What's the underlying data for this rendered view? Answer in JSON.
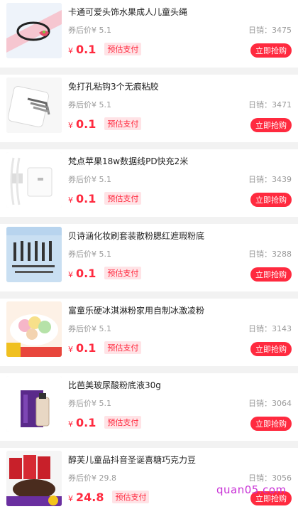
{
  "products": [
    {
      "title": "卡通可爱头饰水果成人儿童头绳",
      "coupon_label": "券后价",
      "coupon_price": "¥ 5.1",
      "sales_label": "日销：",
      "sales": "3475",
      "currency": "¥",
      "price": "0.1",
      "tag": "预估支付",
      "button": "立即抢购",
      "icon": "hair-tie-image"
    },
    {
      "title": "免打孔粘钩3个无痕粘胶",
      "coupon_label": "券后价",
      "coupon_price": "¥ 5.1",
      "sales_label": "日销：",
      "sales": "3471",
      "currency": "¥",
      "price": "0.1",
      "tag": "预估支付",
      "button": "立即抢购",
      "icon": "adhesive-hook-image"
    },
    {
      "title": "梵点苹果18w数据线PD快充2米",
      "coupon_label": "券后价",
      "coupon_price": "¥ 5.1",
      "sales_label": "日销：",
      "sales": "3439",
      "currency": "¥",
      "price": "0.1",
      "tag": "预估支付",
      "button": "立即抢购",
      "icon": "charger-cable-image"
    },
    {
      "title": "贝诗涵化妆刷套装散粉腮红遮瑕粉底",
      "coupon_label": "券后价",
      "coupon_price": "¥ 5.1",
      "sales_label": "日销：",
      "sales": "3288",
      "currency": "¥",
      "price": "0.1",
      "tag": "预估支付",
      "button": "立即抢购",
      "icon": "makeup-brush-image"
    },
    {
      "title": "富童乐硬冰淇淋粉家用自制冰激凌粉",
      "coupon_label": "券后价",
      "coupon_price": "¥ 5.1",
      "sales_label": "日销：",
      "sales": "3143",
      "currency": "¥",
      "price": "0.1",
      "tag": "预估支付",
      "button": "立即抢购",
      "icon": "ice-cream-image"
    },
    {
      "title": "比芭美玻尿酸粉底液30g",
      "coupon_label": "券后价",
      "coupon_price": "¥ 5.1",
      "sales_label": "日销：",
      "sales": "3064",
      "currency": "¥",
      "price": "0.1",
      "tag": "预估支付",
      "button": "立即抢购",
      "icon": "foundation-bottle-image"
    },
    {
      "title": "醇芙儿童品抖音圣诞喜糖巧克力豆",
      "coupon_label": "券后价",
      "coupon_price": "¥ 29.8",
      "sales_label": "日销：",
      "sales": "3056",
      "currency": "¥",
      "price": "24.8",
      "tag": "预估支付",
      "button": "立即抢购",
      "icon": "chocolate-image"
    }
  ],
  "watermark": "quan05.com"
}
